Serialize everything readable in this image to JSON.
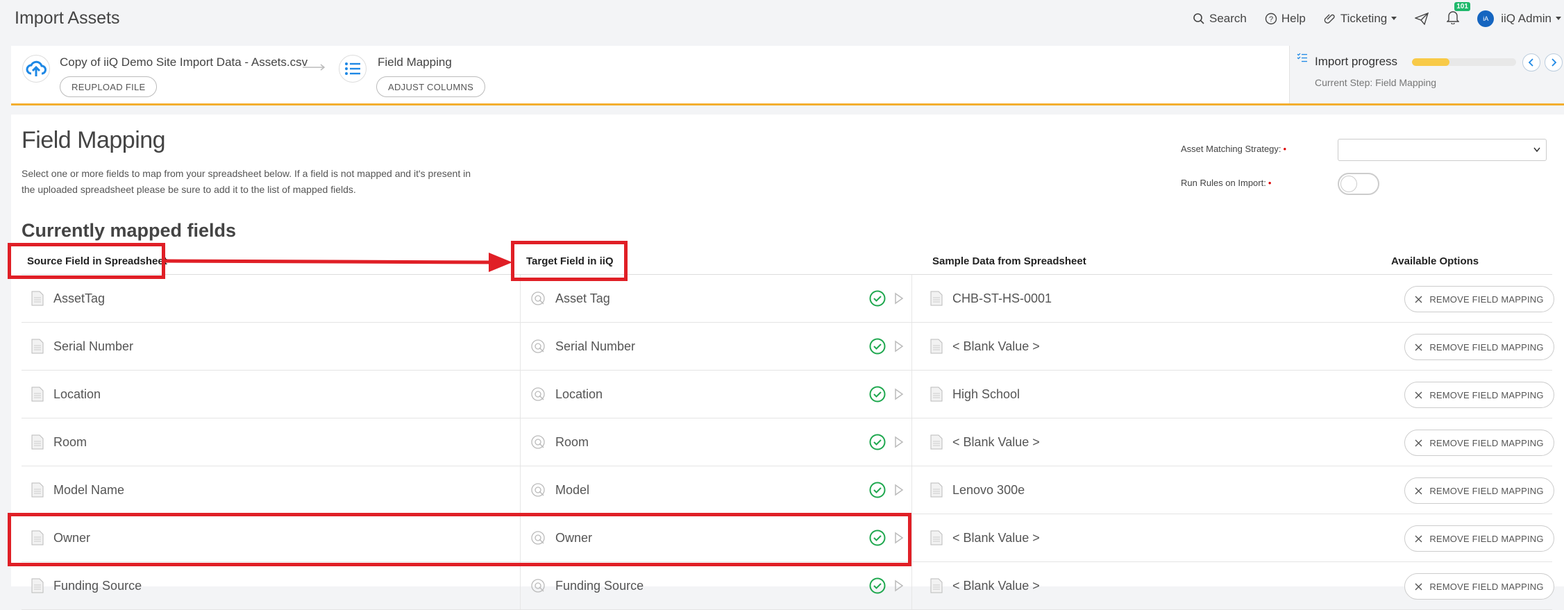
{
  "topbar": {
    "title": "Import Assets",
    "search_label": "Search",
    "help_label": "Help",
    "ticketing_label": "Ticketing",
    "notification_count": "101",
    "avatar_initials": "iA",
    "user_name": "iiQ Admin"
  },
  "stepper": {
    "file_name": "Copy of iiQ Demo Site Import Data - Assets.csv",
    "reupload_label": "REUPLOAD FILE",
    "step_name": "Field Mapping",
    "adjust_label": "ADJUST COLUMNS",
    "progress_label": "Import progress",
    "progress_fraction": 0.36,
    "current_step": "Current Step: Field Mapping"
  },
  "main": {
    "title": "Field Mapping",
    "description": "Select one or more fields to map from your spreadsheet below. If a field is not mapped and it's present in the uploaded spreadsheet please be sure to add it to the list of mapped fields.",
    "matching_label": "Asset Matching Strategy:",
    "rules_label": "Run Rules on Import:",
    "mapped_title": "Currently mapped fields"
  },
  "table": {
    "headers": {
      "source": "Source Field in Spreadsheet",
      "target": "Target Field in iiQ",
      "sample": "Sample Data from Spreadsheet",
      "options": "Available Options"
    },
    "remove_label": "REMOVE FIELD MAPPING",
    "rows": [
      {
        "source": "AssetTag",
        "target": "Asset Tag",
        "sample": "CHB-ST-HS-0001"
      },
      {
        "source": "Serial Number",
        "target": "Serial Number",
        "sample": "< Blank Value >"
      },
      {
        "source": "Location",
        "target": "Location",
        "sample": "High School"
      },
      {
        "source": "Room",
        "target": "Room",
        "sample": "< Blank Value >"
      },
      {
        "source": "Model Name",
        "target": "Model",
        "sample": "Lenovo 300e"
      },
      {
        "source": "Owner",
        "target": "Owner",
        "sample": "< Blank Value >"
      },
      {
        "source": "Funding Source",
        "target": "Funding Source",
        "sample": "< Blank Value >"
      }
    ]
  },
  "colors": {
    "accent_orange": "#f3ae2e",
    "progress_fill": "#f8ca48",
    "check_green": "#1fa84f",
    "annotation_red": "#e01f26",
    "brand_blue": "#1e88e5"
  }
}
